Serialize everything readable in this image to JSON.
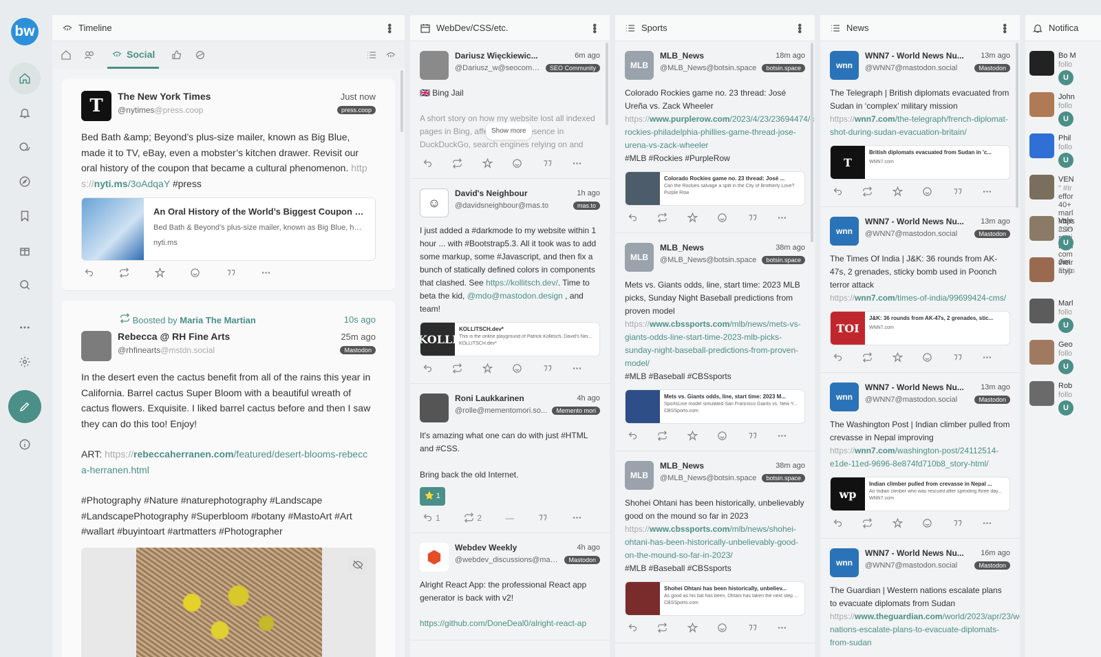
{
  "app": {
    "logo": "bw"
  },
  "nav": [
    "home-icon",
    "bell-icon",
    "chat-icon",
    "compass-icon",
    "bookmark-icon",
    "gift-icon",
    "search-icon",
    "more-icon",
    "settings-icon"
  ],
  "timeline": {
    "title": "Timeline",
    "social_label": "Social",
    "post1": {
      "name": "The New York Times",
      "handle": "@nytimes",
      "domain": "@press.coop",
      "time": "Just now",
      "badge": "press.coop",
      "text": "Bed Bath &amp; Beyond’s plus-size mailer, known as Big Blue, made it to TV, eBay, even a mobster’s kitchen drawer. Revisit our oral history of the coupon that became a cultural phenomenon. ",
      "link_pre": "http s://",
      "link_main": "nyti.ms",
      "link_post": "/3oAdqaY",
      "tag": " #press",
      "card": {
        "title": "An Oral History of the World’s Biggest Coupon (Pu...",
        "desc": "Bed Bath & Beyond’s plus-size mailer, known as Big Blue, has mad...",
        "site": "nyti.ms"
      }
    },
    "boost": {
      "label": "Boosted by",
      "by": "Maria The Martian",
      "time": "10s ago"
    },
    "post2": {
      "name": "Rebecca @ RH Fine Arts",
      "handle": "@rhfinearts",
      "domain": "@mstdn.social",
      "time": "25m ago",
      "badge": "Mastodon",
      "p1": "In the desert even the cactus benefit from all of the rains this year in California. Barrel cactus Super Bloom with a beautiful wreath of cactus flowers. Exquisite. I liked barrel cactus before and then I saw they can do this too! Enjoy!",
      "art_label": "ART: ",
      "art_pre": "https://",
      "art_main": "rebeccaherranen.com",
      "art_post": "/featured/desert-blooms-rebecc a-herranen.html",
      "tags": "#Photography #Nature #naturephotography #Landscape #LandscapePhotography  #Superbloom #botany #MastoArt #Art #wallart #buyintoart #artmatters #Photographer"
    }
  },
  "webdev": {
    "title": "WebDev/CSS/etc.",
    "posts": [
      {
        "name": "Dariusz Więckiewic...",
        "handle": "@Dariusz_w@seocomm...",
        "time": "6m ago",
        "badge": "SEO Community",
        "flag": "🇬🇧 Bing Jail",
        "text": "A short story on how my website lost all indexed pages in Bing, affecting my presence in DuckDuckGo, search engines relying on and",
        "showmore": "Show more"
      },
      {
        "name": "David's Neighbour",
        "handle": "@davidsneighbour@mas.to",
        "time": "1h ago",
        "badge": "mas.to",
        "text": "I just added a #darkmode to my website within 1 hour ... with #Bootstrap5.3. All it took was to add some markup, some #Javascript, and then fix a bunch of statically defined colors in components that clashed.  See ",
        "link": "https://kollitsch.dev/",
        "text2": ". Time to beta the kid, ",
        "mention": "@mdo@mastodon.design",
        "text3": " , and team!",
        "card": {
          "title": "KOLLITSCH.dev*",
          "desc": "This is the online playground of Patrick Kollitsch, David's Nei...",
          "site": "KOLLITSCH.dev*"
        }
      },
      {
        "name": "Roni Laukkarinen",
        "handle": "@rolle@mementomori.so...",
        "time": "4h ago",
        "badge": "Memento mori",
        "text": "It's amazing what one can do with just #HTML and #CSS.",
        "text2": "Bring back the old Internet.",
        "emoji": "⭐ 1",
        "reply": "1",
        "boost": "2"
      },
      {
        "name": "Webdev Weekly",
        "handle": "@webdev_discussions@mast...",
        "time": "4h ago",
        "badge": "Mastodon",
        "text": "Alright React App: the professional React app generator is back with v2!",
        "link": "https://github.com/DoneDeal0/alright-react-ap"
      }
    ]
  },
  "sports": {
    "title": "Sports",
    "posts": [
      {
        "name": "MLB_News",
        "handle": "@MLB_News@botsin.space",
        "time": "18m ago",
        "badge": "botsin.space",
        "text": "Colorado Rockies game no. 23 thread: José Ureña vs. Zack Wheeler",
        "link_pre": "https://",
        "link_main": "www.purplerow.com",
        "link_post": "/2023/4/23/23694474/colorado-rockies-philadelphia-phillies-game-thread-jose-urena-vs-zack-wheeler",
        "tags": "#MLB #Rockies #PurpleRow",
        "card": {
          "title": "Colorado Rockies game no. 23 thread: José ...",
          "desc": "Can the Rockies salvage a split in the City of Brotherly Love?",
          "site": "Purple Row"
        }
      },
      {
        "name": "MLB_News",
        "handle": "@MLB_News@botsin.space",
        "time": "38m ago",
        "badge": "botsin.space",
        "text": "Mets vs. Giants odds, line, start time: 2023 MLB picks, Sunday Night Baseball predictions from proven model",
        "link_pre": "https://",
        "link_main": "www.cbssports.com",
        "link_post": "/mlb/news/mets-vs-giants-odds-line-start-time-2023-mlb-picks-sunday-night-baseball-predictions-from-proven-model/",
        "tags": "#MLB #Baseball #CBSsports",
        "card": {
          "title": "Mets vs. Giants odds, line, start time: 2023 M...",
          "desc": "SportsLine model simulated San Francisco Giants vs. New Y...",
          "site": "CBSSports.com"
        }
      },
      {
        "name": "MLB_News",
        "handle": "@MLB_News@botsin.space",
        "time": "38m ago",
        "badge": "botsin.space",
        "text": "Shohei Ohtani has been historically, unbelievably good on the mound so far in 2023",
        "link_pre": "https://",
        "link_main": "www.cbssports.com",
        "link_post": "/mlb/news/shohei-ohtani-has-been-historically-unbelievably-good-on-the-mound-so-far-in-2023/",
        "tags": "#MLB #Baseball #CBSsports",
        "card": {
          "title": "Shohei Ohtani has been historically, unbeliev...",
          "desc": "As good as his bat has been, Ohtani has taken the next step ...",
          "site": "CBSSports.com"
        }
      }
    ]
  },
  "news": {
    "title": "News",
    "posts": [
      {
        "name": "WNN7 - World News Nu...",
        "handle": "@WNN7@mastodon.social",
        "time": "13m ago",
        "badge": "Mastodon",
        "text": "The Telegraph | British diplomats evacuated from Sudan in ‘complex’ military mission",
        "link_pre": "https://",
        "link_main": "wnn7.com",
        "link_post": "/the-telegraph/french-diplomat-shot-during-sudan-evacuation-britain/",
        "card": {
          "title": "British diplomats evacuated from Sudan in 'c...",
          "desc": "",
          "site": "WNN7.com"
        }
      },
      {
        "name": "WNN7 - World News Nu...",
        "handle": "@WNN7@mastodon.social",
        "time": "13m ago",
        "badge": "Mastodon",
        "text": "The Times Of India | J&K: 36 rounds from AK-47s, 2 grenades, sticky bomb used in Poonch terror attack",
        "link_pre": "https://",
        "link_main": "wnn7.com",
        "link_post": "/times-of-india/99699424-cms/",
        "card": {
          "title": "J&K: 36 rounds from AK-47s, 2 grenades, stic...",
          "desc": "",
          "site": "WNN7.com"
        }
      },
      {
        "name": "WNN7 - World News Nu...",
        "handle": "@WNN7@mastodon.social",
        "time": "13m ago",
        "badge": "Mastodon",
        "text": "The Washington Post | Indian climber pulled from crevasse in Nepal improving",
        "link_pre": "https://",
        "link_main": "wnn7.com",
        "link_post": "/washington-post/24112514-e1de-11ed-9696-8e874fd710b8_story-html/",
        "card": {
          "title": "Indian climber pulled from crevasse in Nepal ...",
          "desc": "An Indian climber who was rescued after spending three day...",
          "site": "WNN7.com"
        }
      },
      {
        "name": "WNN7 - World News Nu...",
        "handle": "@WNN7@mastodon.social",
        "time": "16m ago",
        "badge": "Mastodon",
        "text": "The Guardian | Western nations escalate plans to evacuate diplomats from Sudan",
        "link_pre": "https://",
        "link_main": "www.theguardian.com",
        "link_post": "/world/2023/apr/23/western-nations-escalate-plans-to-evacuate-diplomats-from-sudan"
      }
    ]
  },
  "notifications": {
    "title": "Notifica",
    "items": [
      {
        "name": "Bo M",
        "sub": "follo"
      },
      {
        "name": "John",
        "sub": "follo"
      },
      {
        "name": "Phil",
        "sub": "follo"
      },
      {
        "name": "VEN",
        "sub": "\" #Ir"
      },
      {
        "name": "Vale",
        "sub": "follo"
      },
      {
        "name": "Jim",
        "sub": "Follo"
      },
      {
        "name": "Marl",
        "sub": "follo"
      },
      {
        "name": "Geo",
        "sub": "follo"
      },
      {
        "name": "Rob",
        "sub": "follo"
      }
    ],
    "ven_lines": [
      "effor",
      "40+",
      "marl",
      "https",
      "JSO",
      "stati",
      "then",
      "com",
      "their",
      "atyp"
    ],
    "u_label": "U"
  },
  "colors": {
    "accent": "#4a8f88",
    "bg": "#e9ecef"
  }
}
